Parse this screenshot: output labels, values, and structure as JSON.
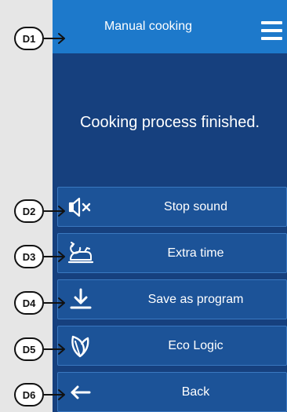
{
  "header": {
    "title": "Manual cooking",
    "menu_icon": "hamburger-menu-icon"
  },
  "status_message": "Cooking process finished.",
  "buttons": [
    {
      "label": "Stop sound",
      "icon": "speaker-mute-icon"
    },
    {
      "label": "Extra time",
      "icon": "extra-time-icon"
    },
    {
      "label": "Save as program",
      "icon": "download-icon"
    },
    {
      "label": "Eco Logic",
      "icon": "leaf-icon"
    },
    {
      "label": "Back",
      "icon": "back-arrow-icon"
    }
  ],
  "callouts": [
    "D1",
    "D2",
    "D3",
    "D4",
    "D5",
    "D6"
  ],
  "colors": {
    "titlebar": "#1d79cb",
    "panel": "#16407e",
    "button": "#1c5398",
    "text": "#ffffff"
  }
}
